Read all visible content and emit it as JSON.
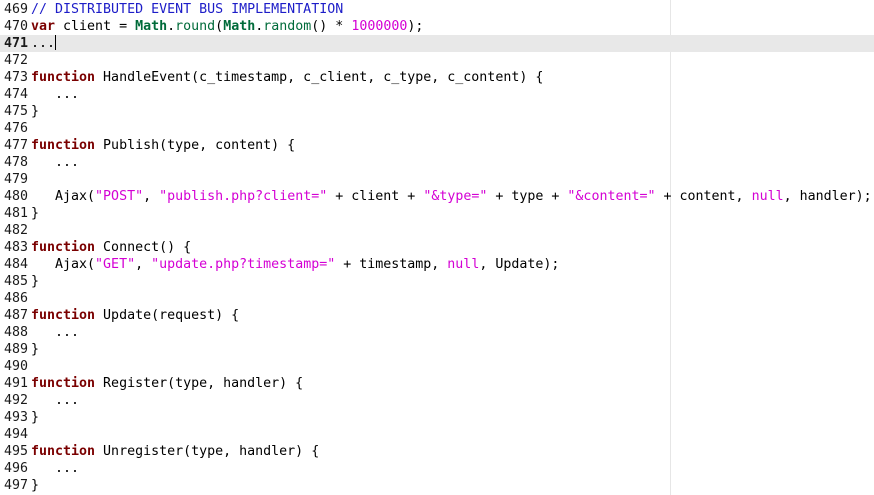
{
  "editor": {
    "current_line": "471",
    "lines": [
      {
        "n": "469",
        "tokens": [
          {
            "t": "// DISTRIBUTED EVENT BUS IMPLEMENTATION",
            "c": "cm"
          }
        ]
      },
      {
        "n": "470",
        "tokens": [
          {
            "t": "var",
            "c": "kw"
          },
          {
            "t": " client = ",
            "c": ""
          },
          {
            "t": "Math",
            "c": "obj"
          },
          {
            "t": ".",
            "c": ""
          },
          {
            "t": "round",
            "c": "fnc"
          },
          {
            "t": "(",
            "c": ""
          },
          {
            "t": "Math",
            "c": "obj"
          },
          {
            "t": ".",
            "c": ""
          },
          {
            "t": "random",
            "c": "fnc"
          },
          {
            "t": "() * ",
            "c": ""
          },
          {
            "t": "1000000",
            "c": "num"
          },
          {
            "t": ");",
            "c": ""
          }
        ]
      },
      {
        "n": "471",
        "tokens": [
          {
            "t": "...",
            "c": ""
          }
        ]
      },
      {
        "n": "472",
        "tokens": []
      },
      {
        "n": "473",
        "tokens": [
          {
            "t": "function",
            "c": "kw"
          },
          {
            "t": " HandleEvent(c_timestamp, c_client, c_type, c_content) {",
            "c": ""
          }
        ]
      },
      {
        "n": "474",
        "tokens": [
          {
            "t": "   ...",
            "c": ""
          }
        ]
      },
      {
        "n": "475",
        "tokens": [
          {
            "t": "}",
            "c": ""
          }
        ]
      },
      {
        "n": "476",
        "tokens": []
      },
      {
        "n": "477",
        "tokens": [
          {
            "t": "function",
            "c": "kw"
          },
          {
            "t": " Publish(type, content) {",
            "c": ""
          }
        ]
      },
      {
        "n": "478",
        "tokens": [
          {
            "t": "   ...",
            "c": ""
          }
        ]
      },
      {
        "n": "479",
        "tokens": []
      },
      {
        "n": "480",
        "tokens": [
          {
            "t": "   Ajax(",
            "c": ""
          },
          {
            "t": "\"POST\"",
            "c": "str"
          },
          {
            "t": ", ",
            "c": ""
          },
          {
            "t": "\"publish.php?client=\"",
            "c": "str"
          },
          {
            "t": " + client + ",
            "c": ""
          },
          {
            "t": "\"&type=\"",
            "c": "str"
          },
          {
            "t": " + type + ",
            "c": ""
          },
          {
            "t": "\"&content=\"",
            "c": "str"
          },
          {
            "t": " + content, ",
            "c": ""
          },
          {
            "t": "null",
            "c": "str"
          },
          {
            "t": ", handler);",
            "c": ""
          }
        ]
      },
      {
        "n": "481",
        "tokens": [
          {
            "t": "}",
            "c": ""
          }
        ]
      },
      {
        "n": "482",
        "tokens": []
      },
      {
        "n": "483",
        "tokens": [
          {
            "t": "function",
            "c": "kw"
          },
          {
            "t": " Connect() {",
            "c": ""
          }
        ]
      },
      {
        "n": "484",
        "tokens": [
          {
            "t": "   Ajax(",
            "c": ""
          },
          {
            "t": "\"GET\"",
            "c": "str"
          },
          {
            "t": ", ",
            "c": ""
          },
          {
            "t": "\"update.php?timestamp=\"",
            "c": "str"
          },
          {
            "t": " + timestamp, ",
            "c": ""
          },
          {
            "t": "null",
            "c": "str"
          },
          {
            "t": ", Update);",
            "c": ""
          }
        ]
      },
      {
        "n": "485",
        "tokens": [
          {
            "t": "}",
            "c": ""
          }
        ]
      },
      {
        "n": "486",
        "tokens": []
      },
      {
        "n": "487",
        "tokens": [
          {
            "t": "function",
            "c": "kw"
          },
          {
            "t": " Update(request) {",
            "c": ""
          }
        ]
      },
      {
        "n": "488",
        "tokens": [
          {
            "t": "   ...",
            "c": ""
          }
        ]
      },
      {
        "n": "489",
        "tokens": [
          {
            "t": "}",
            "c": ""
          }
        ]
      },
      {
        "n": "490",
        "tokens": []
      },
      {
        "n": "491",
        "tokens": [
          {
            "t": "function",
            "c": "kw"
          },
          {
            "t": " Register(type, handler) {",
            "c": ""
          }
        ]
      },
      {
        "n": "492",
        "tokens": [
          {
            "t": "   ...",
            "c": ""
          }
        ]
      },
      {
        "n": "493",
        "tokens": [
          {
            "t": "}",
            "c": ""
          }
        ]
      },
      {
        "n": "494",
        "tokens": []
      },
      {
        "n": "495",
        "tokens": [
          {
            "t": "function",
            "c": "kw"
          },
          {
            "t": " Unregister(type, handler) {",
            "c": ""
          }
        ]
      },
      {
        "n": "496",
        "tokens": [
          {
            "t": "   ...",
            "c": ""
          }
        ]
      },
      {
        "n": "497",
        "tokens": [
          {
            "t": "}",
            "c": ""
          }
        ]
      }
    ]
  }
}
